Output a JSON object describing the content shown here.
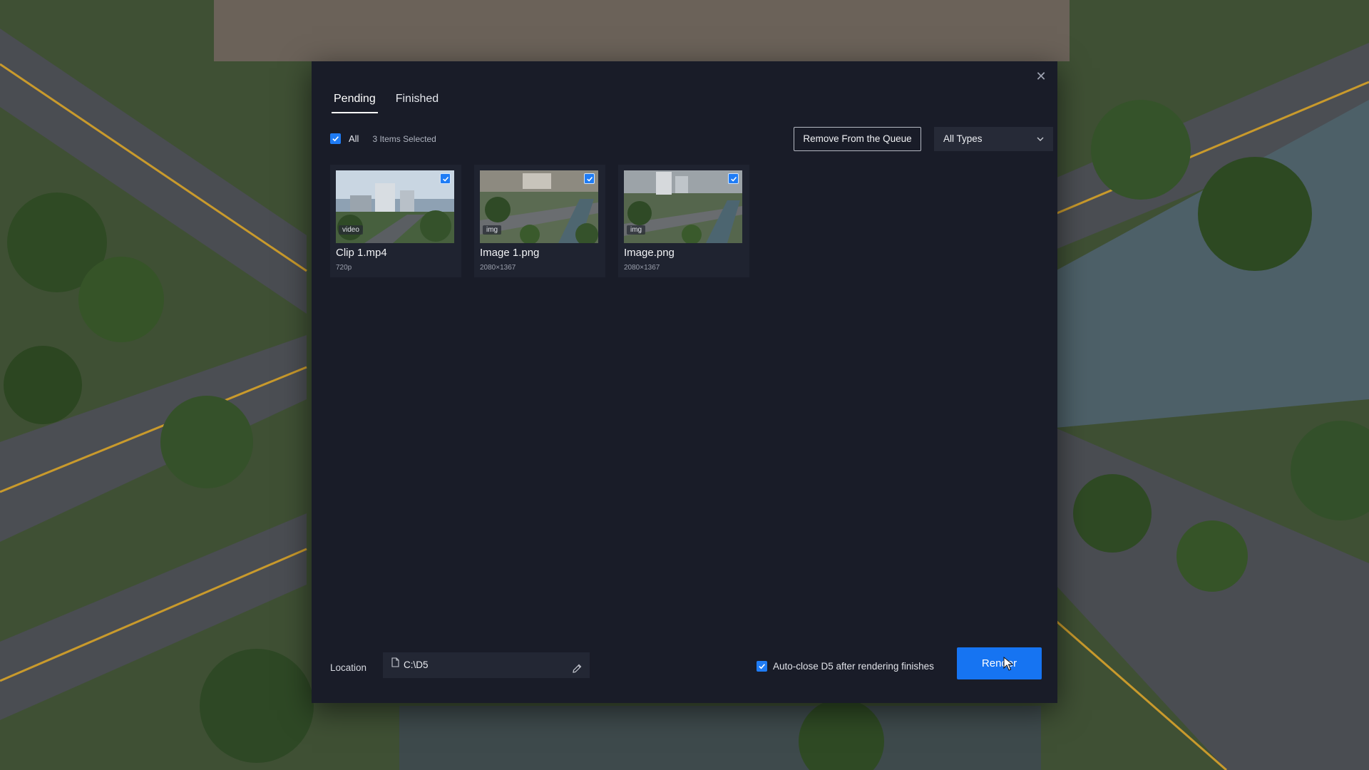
{
  "dialog": {
    "tabs": [
      {
        "label": "Pending",
        "active": true
      },
      {
        "label": "Finished",
        "active": false
      }
    ],
    "close_icon": "close-icon"
  },
  "toolbar": {
    "select_all_label": "All",
    "select_all_checked": true,
    "selected_count": "3 Items Selected",
    "remove_button": "Remove From the Queue",
    "type_filter": {
      "selected": "All Types"
    }
  },
  "queue_items": [
    {
      "name": "Clip 1.mp4",
      "detail": "720p",
      "badge": "video",
      "checked": true
    },
    {
      "name": "Image 1.png",
      "detail": "2080×1367",
      "badge": "img",
      "checked": true
    },
    {
      "name": "Image.png",
      "detail": "2080×1367",
      "badge": "img",
      "checked": true
    }
  ],
  "footer": {
    "location_label": "Location",
    "location_path": "C:\\D5",
    "auto_close_label": "Auto-close D5 after rendering finishes",
    "auto_close_checked": true,
    "render_button": "Render"
  },
  "colors": {
    "dialog_bg": "#191c28",
    "accent": "#1674f2",
    "checkbox": "#1f7cf5"
  }
}
